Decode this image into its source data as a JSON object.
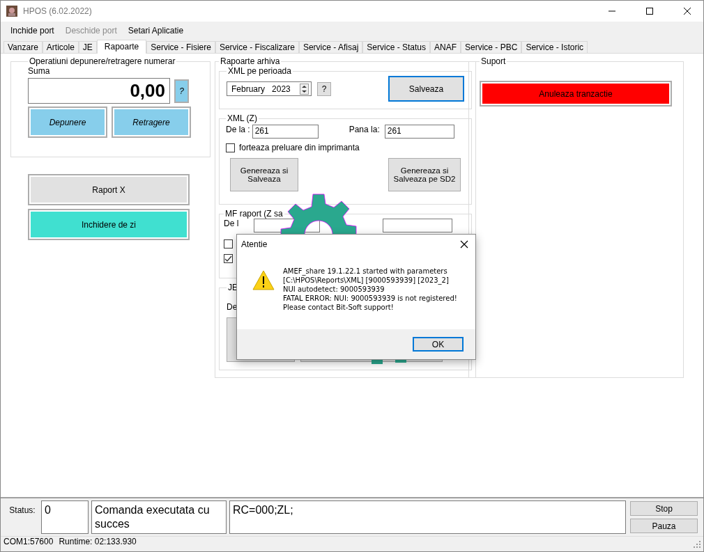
{
  "window": {
    "title": "HPOS (6.02.2022)"
  },
  "menu": [
    {
      "label": "Inchide port",
      "disabled": false
    },
    {
      "label": "Deschide port",
      "disabled": true
    },
    {
      "label": "Setari Aplicatie",
      "disabled": false
    }
  ],
  "tabs": [
    {
      "label": "Vanzare",
      "selected": false
    },
    {
      "label": "Articole",
      "selected": false
    },
    {
      "label": "JE",
      "selected": false
    },
    {
      "label": "Rapoarte",
      "selected": true
    },
    {
      "label": "Service - Fisiere",
      "selected": false
    },
    {
      "label": "Service - Fiscalizare",
      "selected": false
    },
    {
      "label": "Service - Afisaj",
      "selected": false
    },
    {
      "label": "Service - Status",
      "selected": false
    },
    {
      "label": "ANAF",
      "selected": false
    },
    {
      "label": "Service - PBC",
      "selected": false
    },
    {
      "label": "Service - Istoric",
      "selected": false
    }
  ],
  "cash_operations": {
    "title": "Operatiuni depunere/retragere numerar",
    "amount_label": "Suma",
    "amount": "0,00",
    "help": "?",
    "buttons": [
      "Depunere",
      "Retragere"
    ]
  },
  "actions": [
    {
      "label": "Raport X",
      "color": "#e1e1e1"
    },
    {
      "label": "Inchidere de zi",
      "color": "#40e0d0"
    }
  ],
  "archive": {
    "title": "Rapoarte arhiva",
    "xml_period": {
      "title": "XML pe perioada",
      "month": "February",
      "year": "2023",
      "help": "?",
      "save": "Salveaza"
    },
    "xml_z": {
      "title": "XML (Z)",
      "from_label": "De la :",
      "from": "261",
      "to_label": "Pana la:",
      "to": "261",
      "force": {
        "label": "forteaza preluare din imprimanta",
        "checked": false
      },
      "buttons": [
        "Genereaza si Salveaza",
        "Genereaza si Salveaza pe SD2"
      ]
    },
    "mf_report": {
      "title": "MF raport (Z sa",
      "from_label": "De l",
      "checkboxes": [
        {
          "checked": false
        },
        {
          "checked": true
        }
      ]
    },
    "je_report": {
      "title": "JE",
      "from_label": "De"
    }
  },
  "support": {
    "title": "Suport",
    "cancel": "Anuleaza tranzactie"
  },
  "status": {
    "label": "Status:",
    "code": "0",
    "message": "Comanda executata cu succes",
    "response": "RC=000;ZL;",
    "buttons": [
      "Stop",
      "Pauza"
    ]
  },
  "footer": {
    "port": "COM1:57600",
    "runtime": "Runtime: 02:133.930"
  },
  "dialog": {
    "title": "Atentie",
    "lines": [
      "AMEF_share 19.1.22.1 started with parameters",
      "[C:\\HPOS\\Reports\\XML] [9000593939] [2023_2]",
      "NUI autodetect: 9000593939",
      "FATAL ERROR: NUI: 9000593939 is not registered!",
      "Please contact Bit-Soft support!"
    ],
    "button": "OK"
  }
}
